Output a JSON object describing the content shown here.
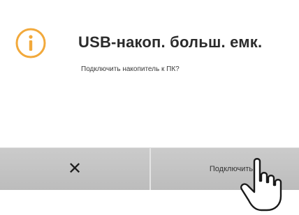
{
  "dialog": {
    "title": "USB-накоп. больш. емк.",
    "message": "Подключить накопитель к ПК?",
    "icon": "info-icon"
  },
  "buttons": {
    "cancel_icon": "close-icon",
    "cancel_glyph": "✕",
    "connect_label": "Подключить"
  },
  "colors": {
    "icon_accent": "#f2a93b",
    "button_bg": "#c4c4c4",
    "title": "#2b2b2b"
  },
  "overlay": {
    "pointer_icon": "hand-pointer-icon"
  }
}
